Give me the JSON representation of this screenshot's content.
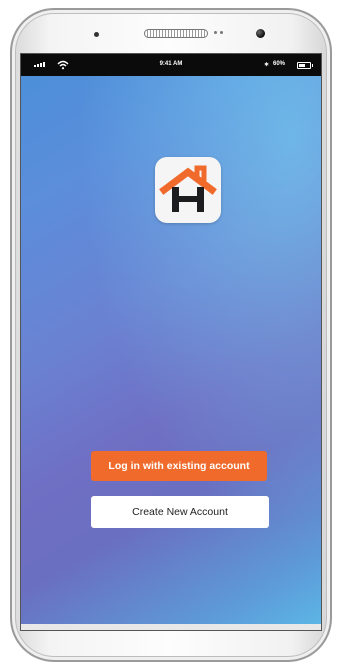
{
  "status_bar": {
    "time": "9:41 AM",
    "battery_text": "60%",
    "bluetooth_glyph": "∗"
  },
  "icons": {
    "signal": "signal-bars-icon",
    "wifi": "wifi-icon",
    "bluetooth": "bluetooth-icon",
    "battery": "battery-icon",
    "app_logo": "house-h-logo-icon"
  },
  "actions": {
    "login_label": "Log in with existing account",
    "create_label": "Create New Account"
  },
  "colors": {
    "accent": "#ef6a2b",
    "logo_dark": "#1d1d1f",
    "gradient_top": "#5cb8e6",
    "gradient_mid": "#6f6fc4"
  }
}
